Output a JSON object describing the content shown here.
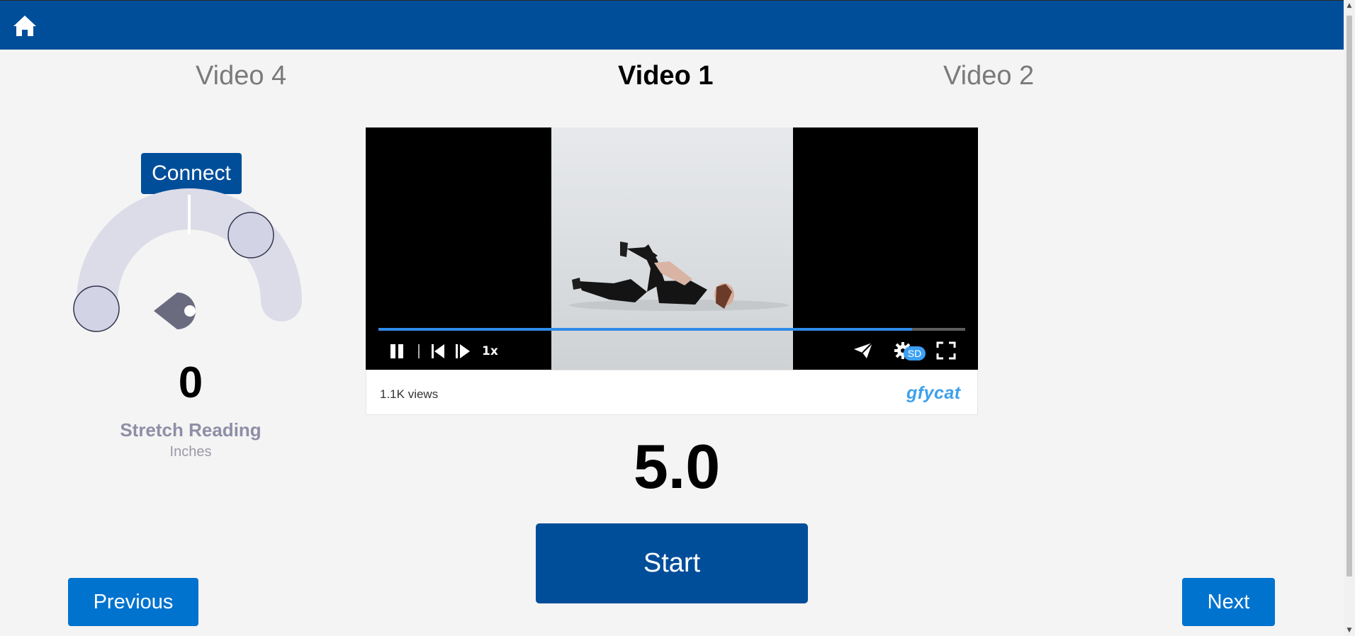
{
  "header": {
    "home_icon": "home-icon",
    "color": "#004e9a"
  },
  "tabs": {
    "left": "Video 4",
    "center": "Video 1",
    "right": "Video 2"
  },
  "sensor": {
    "connect_label": "Connect",
    "value": "0",
    "label": "Stretch Reading",
    "unit": "Inches"
  },
  "video": {
    "progress": 0.91,
    "speed": "1x",
    "quality": "SD",
    "views": "1.1K views",
    "logo": "gfycat"
  },
  "timer": "5.0",
  "buttons": {
    "start": "Start",
    "previous": "Previous",
    "next": "Next"
  },
  "colors": {
    "primary": "#004e9a",
    "nav": "#0073cf",
    "progress": "#2f8ae8",
    "gauge": "#dcdce8",
    "pointer": "#6b6b80"
  }
}
